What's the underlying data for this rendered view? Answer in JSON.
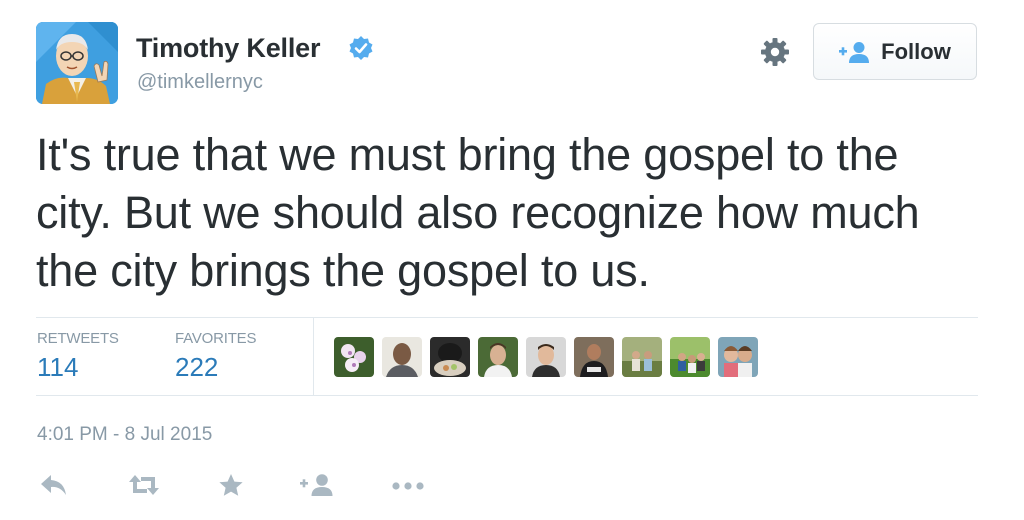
{
  "author": {
    "name": "Timothy Keller",
    "handle": "@timkellernyc",
    "verified": true,
    "verified_color": "#55acee"
  },
  "header": {
    "follow_label": "Follow",
    "follow_icon": "add-user-icon",
    "settings_icon": "gear-icon"
  },
  "tweet": {
    "lines": [
      "It's true that we must bring the gospel to the",
      "city. But we should also recognize how much",
      "the city brings the gospel to us."
    ]
  },
  "stats": {
    "retweets_label": "RETWEETS",
    "retweets_value": "114",
    "favorites_label": "FAVORITES",
    "favorites_value": "222"
  },
  "favoriters": {
    "icon": "user-avatar-icon",
    "count": 9
  },
  "timestamp": "4:01 PM - 8 Jul 2015",
  "actions": [
    "reply-icon",
    "retweet-icon",
    "favorite-icon",
    "follow-icon",
    "more-icon"
  ],
  "colors": {
    "text": "#292f33",
    "muted": "#8899a6",
    "link_blue": "#2b7bb9",
    "divider": "#e1e8ed",
    "action_gray": "#aab8c2"
  }
}
